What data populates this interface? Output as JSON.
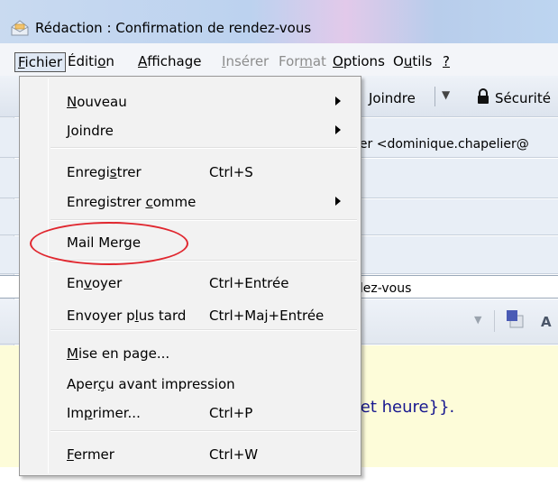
{
  "window": {
    "title": "Rédaction : Confirmation de rendez-vous"
  },
  "menubar": [
    {
      "key": "fichier",
      "pre": "",
      "acc": "F",
      "post": "ichier",
      "state": "active"
    },
    {
      "key": "edition",
      "pre": "Éditi",
      "acc": "o",
      "post": "n",
      "state": "normal"
    },
    {
      "key": "affichage",
      "pre": "",
      "acc": "A",
      "post": "ffichage",
      "state": "normal"
    },
    {
      "key": "inserer",
      "pre": "",
      "acc": "I",
      "post": "nsérer",
      "state": "disabled"
    },
    {
      "key": "format",
      "pre": "For",
      "acc": "m",
      "post": "at",
      "state": "disabled"
    },
    {
      "key": "options",
      "pre": "",
      "acc": "O",
      "post": "ptions",
      "state": "normal"
    },
    {
      "key": "outils",
      "pre": "O",
      "acc": "u",
      "post": "tils",
      "state": "normal"
    },
    {
      "key": "aide",
      "pre": "",
      "acc": "?",
      "post": "",
      "state": "normal"
    }
  ],
  "toolbar": {
    "attach_label": "Joindre",
    "security_label": "Sécurité"
  },
  "header": {
    "from_value": "ier <dominique.chapelier@"
  },
  "subject": {
    "value": "ndez-vous"
  },
  "formatbar": {
    "font_button": "A"
  },
  "editor": {
    "visible_text": "e et heure}}."
  },
  "file_menu": {
    "items": [
      {
        "key": "nouveau",
        "pre": "",
        "acc": "N",
        "post": "ouveau",
        "shortcut": "",
        "submenu": true
      },
      {
        "key": "joindre",
        "pre": "",
        "acc": "J",
        "post": "oindre",
        "shortcut": "",
        "submenu": true
      },
      {
        "key": "enregistrer",
        "pre": "Enregi",
        "acc": "s",
        "post": "trer",
        "shortcut": "Ctrl+S",
        "submenu": false
      },
      {
        "key": "enregistrer-comme",
        "pre": "Enregistrer ",
        "acc": "c",
        "post": "omme",
        "shortcut": "",
        "submenu": true
      },
      {
        "key": "mail-merge",
        "pre": "Mail Merge",
        "acc": "",
        "post": "",
        "shortcut": "",
        "submenu": false
      },
      {
        "key": "envoyer",
        "pre": "En",
        "acc": "v",
        "post": "oyer",
        "shortcut": "Ctrl+Entrée",
        "submenu": false
      },
      {
        "key": "envoyer-plus-tard",
        "pre": "Envoyer p",
        "acc": "l",
        "post": "us tard",
        "shortcut": "Ctrl+Maj+Entrée",
        "submenu": false
      },
      {
        "key": "mise-en-page",
        "pre": "",
        "acc": "M",
        "post": "ise en page...",
        "shortcut": "",
        "submenu": false
      },
      {
        "key": "apercu",
        "pre": "Aper",
        "acc": "ç",
        "post": "u avant impression",
        "shortcut": "",
        "submenu": false
      },
      {
        "key": "imprimer",
        "pre": "Im",
        "acc": "p",
        "post": "rimer...",
        "shortcut": "Ctrl+P",
        "submenu": false
      },
      {
        "key": "fermer",
        "pre": "",
        "acc": "F",
        "post": "ermer",
        "shortcut": "Ctrl+W",
        "submenu": false
      }
    ]
  },
  "colors": {
    "annotation": "#e0262e",
    "editor_bg": "#fdfcd9",
    "editor_text": "#18188f",
    "menu_bg": "#f2f2f2"
  }
}
